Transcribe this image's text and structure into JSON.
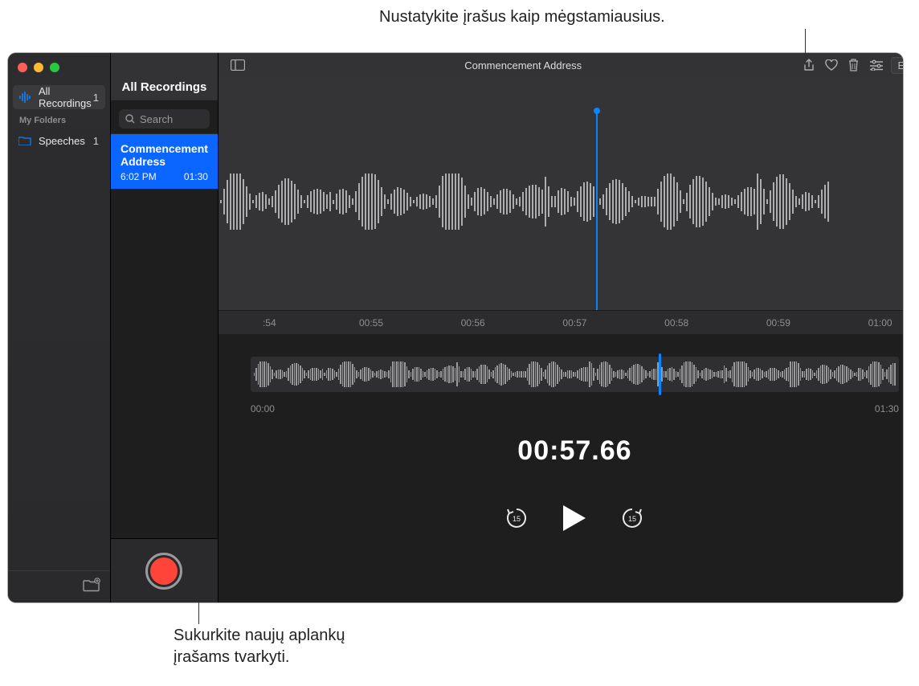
{
  "annotations": {
    "top": "Nustatykite įrašus kaip mėgstamiausius.",
    "bottom_line1": "Sukurkite naujų aplankų",
    "bottom_line2": "įrašams tvarkyti."
  },
  "sidebar": {
    "all_label": "All Recordings",
    "all_count": "1",
    "folders_header": "My Folders",
    "folders": [
      {
        "name": "Speeches",
        "count": "1"
      }
    ]
  },
  "mid": {
    "header": "All Recordings",
    "search_placeholder": "Search",
    "recording": {
      "title": "Commencement Address",
      "time": "6:02 PM",
      "duration": "01:30"
    }
  },
  "detail": {
    "title": "Commencement Address",
    "edit_label": "Edit",
    "ruler": [
      ":54",
      "00:55",
      "00:56",
      "00:57",
      "00:58",
      "00:59",
      "01:00"
    ],
    "overview_start": "00:00",
    "overview_end": "01:30",
    "time_display": "00:57.66",
    "skip_back": "15",
    "skip_forward": "15"
  }
}
